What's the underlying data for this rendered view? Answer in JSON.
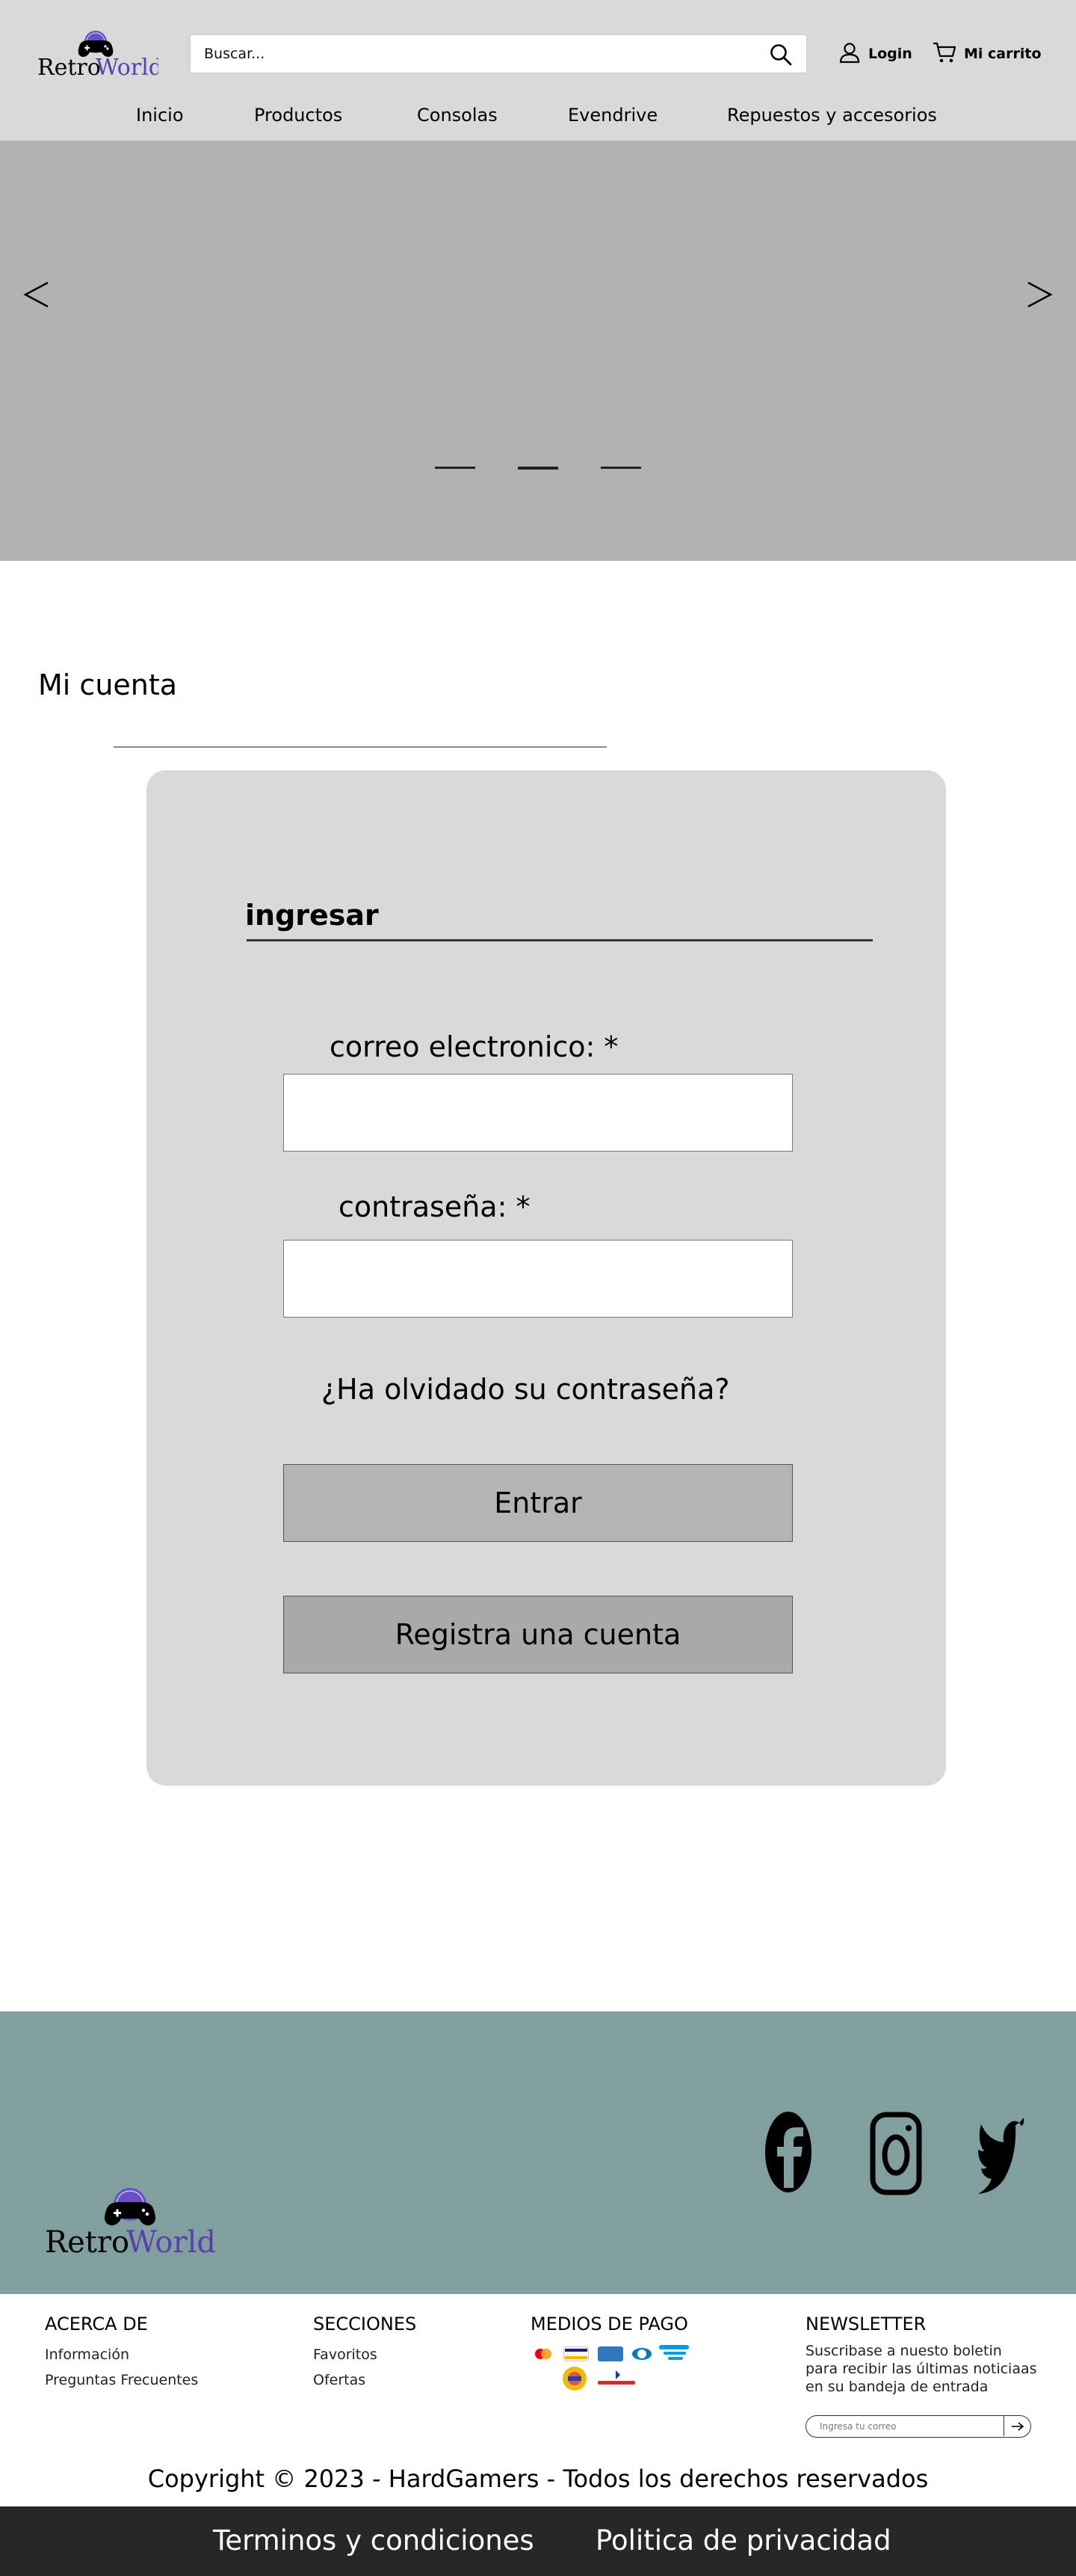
{
  "header": {
    "logo": {
      "part1": "Retro",
      "part2": "World"
    },
    "search": {
      "placeholder": "Buscar..."
    },
    "login_label": "Login",
    "cart_label": "Mi carrito",
    "nav": [
      "Inicio",
      "Productos",
      "Consolas",
      "Evendrive",
      "Repuestos y accesorios"
    ]
  },
  "hero": {
    "prev": "<",
    "next": ">",
    "slides": 3,
    "active_slide": 2
  },
  "main": {
    "title": "Mi cuenta",
    "card": {
      "heading": "ingresar",
      "email_label": "correo electronico: *",
      "email_value": "",
      "password_label": "contraseña: *",
      "password_value": "",
      "forgot": "¿Ha olvidado su contraseña?",
      "login_button": "Entrar",
      "register_button": "Registra una cuenta"
    }
  },
  "footer": {
    "logo": {
      "part1": "Retro",
      "part2": "World"
    },
    "social": [
      "facebook-icon",
      "instagram-icon",
      "twitter-icon"
    ],
    "about": {
      "heading": "ACERCA DE",
      "links": [
        "Información",
        "Preguntas Frecuentes"
      ]
    },
    "sections": {
      "heading": "SECCIONES",
      "links": [
        "Favoritos",
        "Ofertas"
      ]
    },
    "payments": {
      "heading": "MEDIOS DE PAGO",
      "methods": [
        "mastercard",
        "visa",
        "amex",
        "diners",
        "mercado pago",
        "cabal",
        "rapipago"
      ]
    },
    "newsletter": {
      "heading": "NEWSLETTER",
      "text": "Suscribase a nuesto boletin para recibir las últimas noticiaas en su bandeja de entrada",
      "placeholder": "Ingresa tu correo"
    },
    "copyright": "Copyright © 2023 - HardGamers - Todos los derechos reservados",
    "legal": [
      "Terminos y condiciones",
      "Politica de privacidad"
    ]
  },
  "colors": {
    "header_bg": "#d9d9d9",
    "hero_bg": "#b2b2b2",
    "card_bg": "#d9d9d9",
    "primary_button": "#b4b4b4",
    "secondary_button": "#a9a9a9",
    "footer_band": "#819f9e",
    "bottom_bar": "#272727",
    "logo_purple": "#5a3fb0"
  }
}
